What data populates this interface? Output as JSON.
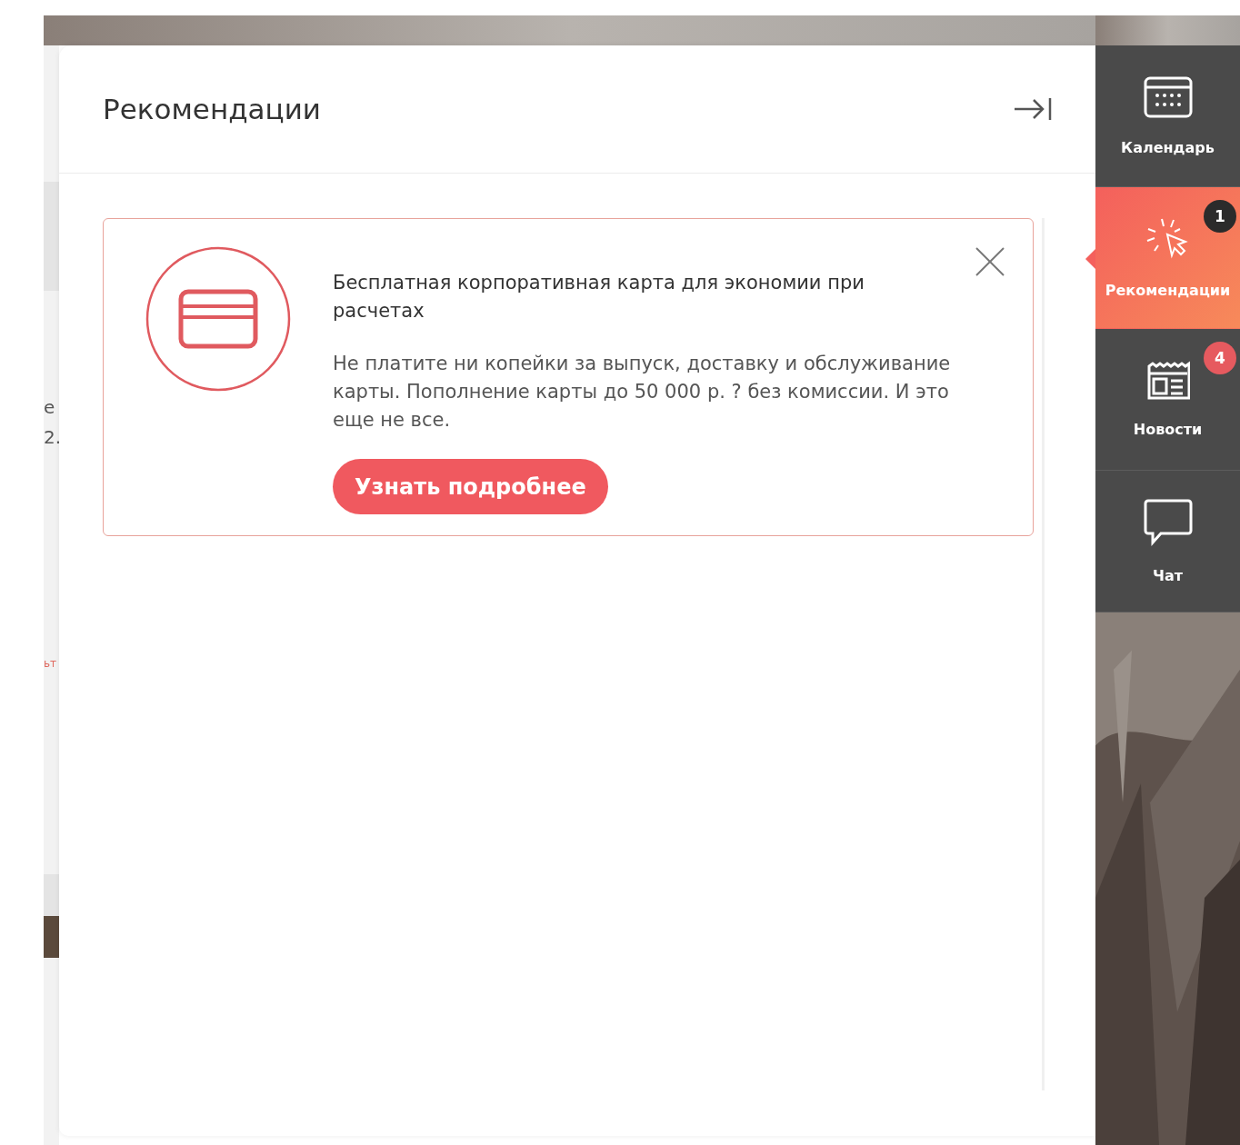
{
  "backdrop": {
    "fragments": [
      "е",
      "2.",
      "ьт"
    ]
  },
  "panel": {
    "title": "Рекомендации",
    "card": {
      "title": "Бесплатная корпоративная карта для экономии при расчетах",
      "text": "Не платите ни копейки за выпуск, доставку и обслуживание карты. Пополнение карты до 50 000 р. ? без комиссии. И это еще не все.",
      "button": "Узнать подробнее"
    }
  },
  "sidebar": {
    "items": [
      {
        "label": "Календарь",
        "selected": false
      },
      {
        "label": "Рекомендации",
        "selected": true,
        "badge": "1",
        "color": "#2b2b2b"
      },
      {
        "label": "Новости",
        "selected": false,
        "badge": "4",
        "color": "#e65a5f"
      },
      {
        "label": "Чат",
        "selected": false
      }
    ]
  }
}
